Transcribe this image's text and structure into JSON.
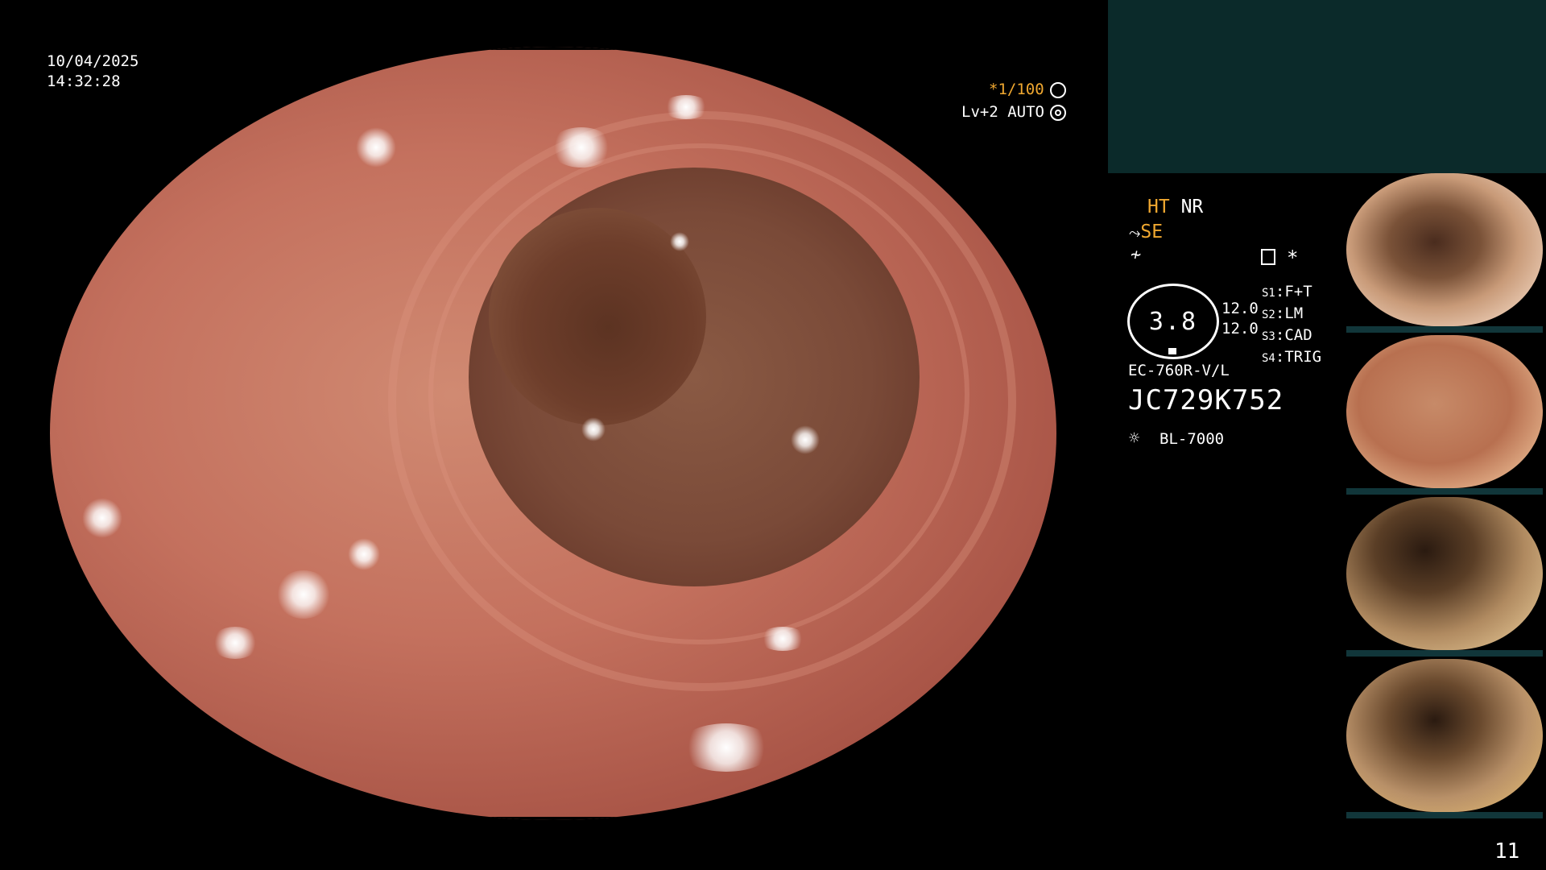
{
  "overlay": {
    "date": "10/04/2025",
    "time": "14:32:28",
    "shutter": "*1/100",
    "shutter_icon": "aperture-icon",
    "enhancement": "Lv+2 AUTO",
    "enhancement_icon": "iris-icon"
  },
  "panel": {
    "mode_ht": "HT",
    "mode_nr": "NR",
    "mode_se": "SE",
    "freeze_icon": "freeze-icon",
    "capture_icon": "memory-card-icon",
    "capture_mark": "*",
    "gauge_value": "3.8",
    "values": [
      "12.0",
      "12.0"
    ],
    "switches": [
      {
        "key": "S1",
        "value": "F+T"
      },
      {
        "key": "S2",
        "value": "LM"
      },
      {
        "key": "S3",
        "value": "CAD"
      },
      {
        "key": "S4",
        "value": "TRIG"
      }
    ],
    "scope_model": "EC-760R-V/L",
    "scope_serial": "JC729K752",
    "light_source": "BL-7000",
    "light_icon": "sun-icon"
  },
  "page_number": "11",
  "thumbnails": [
    {
      "name": "thumbnail-1"
    },
    {
      "name": "thumbnail-2"
    },
    {
      "name": "thumbnail-3"
    },
    {
      "name": "thumbnail-4"
    }
  ],
  "colors": {
    "accent_amber": "#f0a830",
    "panel_teal": "#0b2a2a"
  }
}
